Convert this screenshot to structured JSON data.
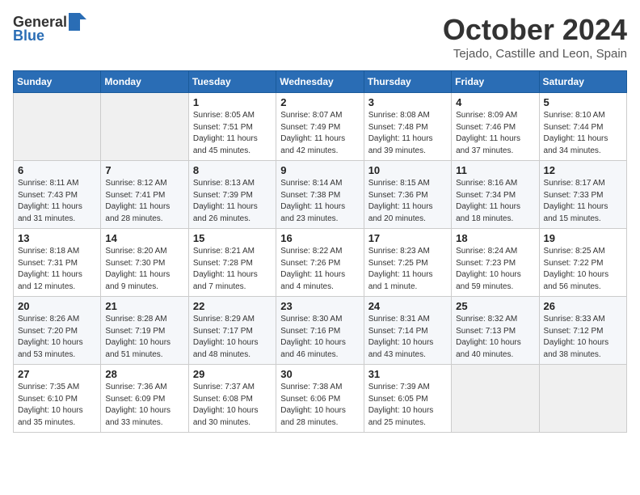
{
  "header": {
    "logo_general": "General",
    "logo_blue": "Blue",
    "month_title": "October 2024",
    "location": "Tejado, Castille and Leon, Spain"
  },
  "days_of_week": [
    "Sunday",
    "Monday",
    "Tuesday",
    "Wednesday",
    "Thursday",
    "Friday",
    "Saturday"
  ],
  "weeks": [
    [
      {
        "day": "",
        "info": ""
      },
      {
        "day": "",
        "info": ""
      },
      {
        "day": "1",
        "info": "Sunrise: 8:05 AM\nSunset: 7:51 PM\nDaylight: 11 hours and 45 minutes."
      },
      {
        "day": "2",
        "info": "Sunrise: 8:07 AM\nSunset: 7:49 PM\nDaylight: 11 hours and 42 minutes."
      },
      {
        "day": "3",
        "info": "Sunrise: 8:08 AM\nSunset: 7:48 PM\nDaylight: 11 hours and 39 minutes."
      },
      {
        "day": "4",
        "info": "Sunrise: 8:09 AM\nSunset: 7:46 PM\nDaylight: 11 hours and 37 minutes."
      },
      {
        "day": "5",
        "info": "Sunrise: 8:10 AM\nSunset: 7:44 PM\nDaylight: 11 hours and 34 minutes."
      }
    ],
    [
      {
        "day": "6",
        "info": "Sunrise: 8:11 AM\nSunset: 7:43 PM\nDaylight: 11 hours and 31 minutes."
      },
      {
        "day": "7",
        "info": "Sunrise: 8:12 AM\nSunset: 7:41 PM\nDaylight: 11 hours and 28 minutes."
      },
      {
        "day": "8",
        "info": "Sunrise: 8:13 AM\nSunset: 7:39 PM\nDaylight: 11 hours and 26 minutes."
      },
      {
        "day": "9",
        "info": "Sunrise: 8:14 AM\nSunset: 7:38 PM\nDaylight: 11 hours and 23 minutes."
      },
      {
        "day": "10",
        "info": "Sunrise: 8:15 AM\nSunset: 7:36 PM\nDaylight: 11 hours and 20 minutes."
      },
      {
        "day": "11",
        "info": "Sunrise: 8:16 AM\nSunset: 7:34 PM\nDaylight: 11 hours and 18 minutes."
      },
      {
        "day": "12",
        "info": "Sunrise: 8:17 AM\nSunset: 7:33 PM\nDaylight: 11 hours and 15 minutes."
      }
    ],
    [
      {
        "day": "13",
        "info": "Sunrise: 8:18 AM\nSunset: 7:31 PM\nDaylight: 11 hours and 12 minutes."
      },
      {
        "day": "14",
        "info": "Sunrise: 8:20 AM\nSunset: 7:30 PM\nDaylight: 11 hours and 9 minutes."
      },
      {
        "day": "15",
        "info": "Sunrise: 8:21 AM\nSunset: 7:28 PM\nDaylight: 11 hours and 7 minutes."
      },
      {
        "day": "16",
        "info": "Sunrise: 8:22 AM\nSunset: 7:26 PM\nDaylight: 11 hours and 4 minutes."
      },
      {
        "day": "17",
        "info": "Sunrise: 8:23 AM\nSunset: 7:25 PM\nDaylight: 11 hours and 1 minute."
      },
      {
        "day": "18",
        "info": "Sunrise: 8:24 AM\nSunset: 7:23 PM\nDaylight: 10 hours and 59 minutes."
      },
      {
        "day": "19",
        "info": "Sunrise: 8:25 AM\nSunset: 7:22 PM\nDaylight: 10 hours and 56 minutes."
      }
    ],
    [
      {
        "day": "20",
        "info": "Sunrise: 8:26 AM\nSunset: 7:20 PM\nDaylight: 10 hours and 53 minutes."
      },
      {
        "day": "21",
        "info": "Sunrise: 8:28 AM\nSunset: 7:19 PM\nDaylight: 10 hours and 51 minutes."
      },
      {
        "day": "22",
        "info": "Sunrise: 8:29 AM\nSunset: 7:17 PM\nDaylight: 10 hours and 48 minutes."
      },
      {
        "day": "23",
        "info": "Sunrise: 8:30 AM\nSunset: 7:16 PM\nDaylight: 10 hours and 46 minutes."
      },
      {
        "day": "24",
        "info": "Sunrise: 8:31 AM\nSunset: 7:14 PM\nDaylight: 10 hours and 43 minutes."
      },
      {
        "day": "25",
        "info": "Sunrise: 8:32 AM\nSunset: 7:13 PM\nDaylight: 10 hours and 40 minutes."
      },
      {
        "day": "26",
        "info": "Sunrise: 8:33 AM\nSunset: 7:12 PM\nDaylight: 10 hours and 38 minutes."
      }
    ],
    [
      {
        "day": "27",
        "info": "Sunrise: 7:35 AM\nSunset: 6:10 PM\nDaylight: 10 hours and 35 minutes."
      },
      {
        "day": "28",
        "info": "Sunrise: 7:36 AM\nSunset: 6:09 PM\nDaylight: 10 hours and 33 minutes."
      },
      {
        "day": "29",
        "info": "Sunrise: 7:37 AM\nSunset: 6:08 PM\nDaylight: 10 hours and 30 minutes."
      },
      {
        "day": "30",
        "info": "Sunrise: 7:38 AM\nSunset: 6:06 PM\nDaylight: 10 hours and 28 minutes."
      },
      {
        "day": "31",
        "info": "Sunrise: 7:39 AM\nSunset: 6:05 PM\nDaylight: 10 hours and 25 minutes."
      },
      {
        "day": "",
        "info": ""
      },
      {
        "day": "",
        "info": ""
      }
    ]
  ]
}
